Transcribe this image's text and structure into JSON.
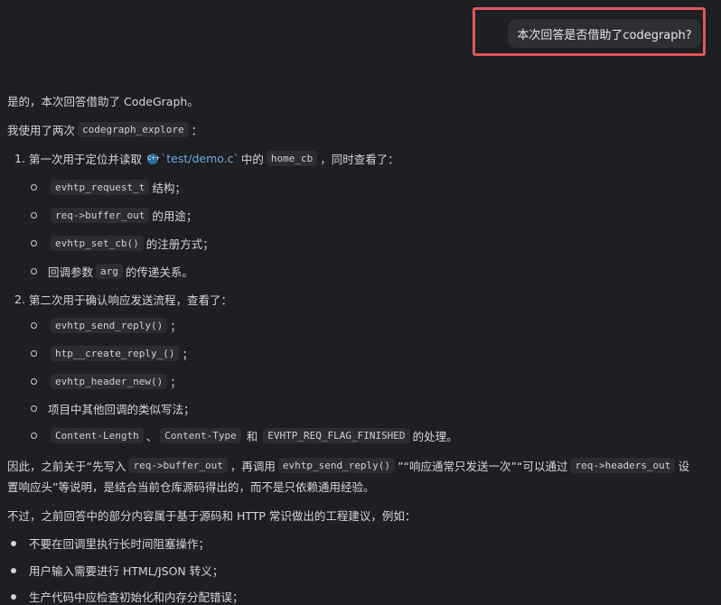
{
  "user_message": "本次回答是否借助了codegraph?",
  "answer": {
    "p1": "是的，本次回答借助了 CodeGraph。",
    "p2_pre": "我使用了两次",
    "p2_code": "codegraph_explore",
    "p2_post": "：",
    "item1": {
      "num": "1.",
      "pre": "第一次用于定位并读取",
      "file": "`test/demo.c`",
      "mid": "中的",
      "code": "home_cb",
      "post": "，同时查看了：",
      "subs": [
        {
          "code": "evhtp_request_t",
          "text": "结构；"
        },
        {
          "code": "req->buffer_out",
          "text": "的用途；"
        },
        {
          "code": "evhtp_set_cb()",
          "text": "的注册方式；"
        },
        {
          "pre": "回调参数",
          "code": "arg",
          "text": "的传递关系。"
        }
      ]
    },
    "item2": {
      "num": "2.",
      "text": "第二次用于确认响应发送流程，查看了：",
      "subs": [
        {
          "code": "evhtp_send_reply()",
          "text": "；"
        },
        {
          "code": "htp__create_reply_()",
          "text": "；"
        },
        {
          "code": "evhtp_header_new()",
          "text": "；"
        },
        {
          "text": "项目中其他回调的类似写法；"
        },
        {
          "code1": "Content-Length",
          "sep1": "、",
          "code2": "Content-Type",
          "sep2": "和",
          "code3": "EVHTP_REQ_FLAG_FINISHED",
          "text": "的处理。"
        }
      ]
    },
    "p3_a": "因此，之前关于“先写入",
    "p3_code1": "req->buffer_out",
    "p3_b": "，再调用",
    "p3_code2": "evhtp_send_reply()",
    "p3_c": "”“响应通常只发送一次”“可以通过",
    "p3_code3": "req->headers_out",
    "p3_d": "设",
    "p3_line2": "置响应头”等说明，是结合当前仓库源码得出的，而不是只依赖通用经验。",
    "p4": "不过，之前回答中的部分内容属于基于源码和 HTTP 常识做出的工程建议，例如：",
    "bullets": [
      "不要在回调里执行长时间阻塞操作；",
      "用户输入需要进行 HTML/JSON 转义；",
      "生产代码中应检查初始化和内存分配错误；"
    ]
  }
}
